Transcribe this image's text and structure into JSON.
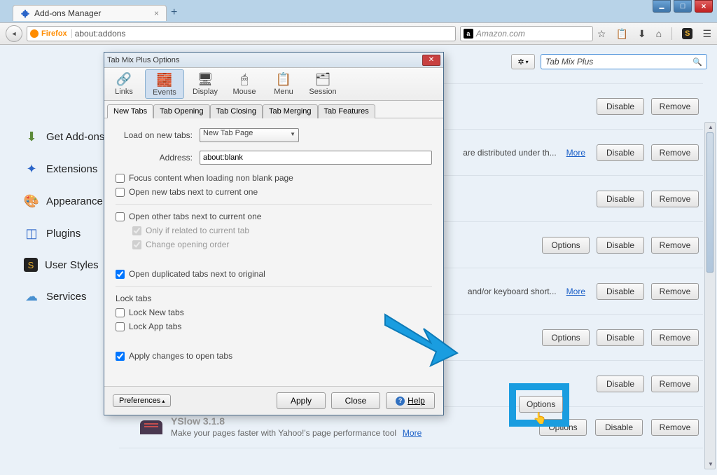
{
  "window": {
    "title": "Add-ons Manager"
  },
  "urlbar": {
    "brand": "Firefox",
    "url": "about:addons",
    "search_placeholder": "Amazon.com"
  },
  "addon_toolbar": {
    "search_value": "Tab Mix Plus"
  },
  "sidebar": {
    "items": [
      {
        "label": "Get Add-ons"
      },
      {
        "label": "Extensions"
      },
      {
        "label": "Appearance"
      },
      {
        "label": "Plugins"
      },
      {
        "label": "User Styles"
      },
      {
        "label": "Services"
      }
    ]
  },
  "addon_rows": [
    {
      "desc": "",
      "options": false
    },
    {
      "desc": "are distributed under th...",
      "more": "More",
      "options": false
    },
    {
      "desc": "",
      "options": false
    },
    {
      "desc": "",
      "options": true
    },
    {
      "desc": "and/or keyboard short...",
      "more": "More",
      "options": false
    },
    {
      "desc": "",
      "options": true
    },
    {
      "desc": "",
      "options": true
    }
  ],
  "buttons": {
    "options": "Options",
    "disable": "Disable",
    "remove": "Remove",
    "more": "More"
  },
  "yslow": {
    "title": "YSlow  3.1.8",
    "desc": "Make your pages faster with Yahoo!'s page performance tool"
  },
  "dialog": {
    "title": "Tab Mix Plus Options",
    "toolbar": [
      {
        "label": "Links",
        "glyph": "🔗"
      },
      {
        "label": "Events",
        "glyph": "🧱"
      },
      {
        "label": "Display",
        "glyph": "🖥"
      },
      {
        "label": "Mouse",
        "glyph": "🖱"
      },
      {
        "label": "Menu",
        "glyph": "📋"
      },
      {
        "label": "Session",
        "glyph": "🗂"
      }
    ],
    "active_tool": 1,
    "tabs": [
      "New Tabs",
      "Tab Opening",
      "Tab Closing",
      "Tab Merging",
      "Tab Features"
    ],
    "active_tab": 0,
    "labels": {
      "load_on": "Load on new tabs:",
      "load_on_value": "New Tab Page",
      "address": "Address:",
      "address_value": "about:blank",
      "focus_content": "Focus content when loading non blank page",
      "open_next": "Open new tabs next to current one",
      "open_other_next": "Open other tabs next to current one",
      "only_related": "Only if related to current tab",
      "change_order": "Change opening order",
      "open_dup": "Open duplicated tabs next to original",
      "lock_section": "Lock tabs",
      "lock_new": "Lock New tabs",
      "lock_app": "Lock App tabs",
      "apply_open": "Apply changes to open tabs"
    },
    "footer": {
      "preferences": "Preferences",
      "apply": "Apply",
      "close": "Close",
      "help": "Help"
    }
  }
}
